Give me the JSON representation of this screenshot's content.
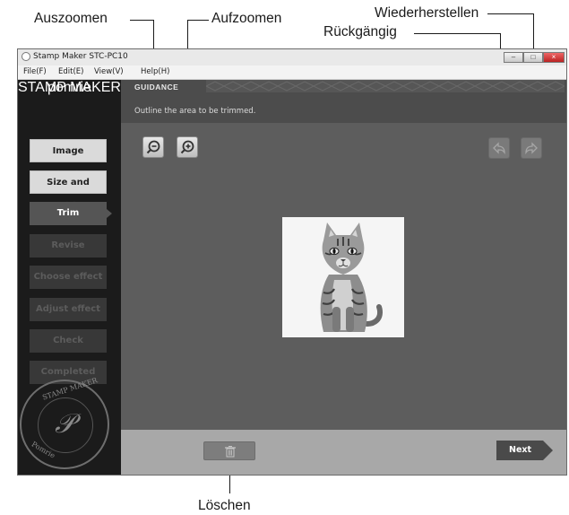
{
  "callouts": {
    "zoom_out": "Auszoomen",
    "zoom_in": "Aufzoomen",
    "redo": "Wiederherstellen",
    "undo": "Rückgängig",
    "delete": "Löschen"
  },
  "window": {
    "title": "Stamp Maker STC-PC10",
    "minimize_icon": "minimize-icon",
    "maximize_icon": "maximize-icon",
    "close_icon": "close-icon"
  },
  "menu": {
    "items": [
      "File(F)",
      "Edit(E)",
      "View(V)",
      "Help(H)"
    ]
  },
  "logo": {
    "name": "pomrie",
    "tagline": "STAMP MAKER"
  },
  "steps": [
    {
      "label": "Image selection",
      "state": "done"
    },
    {
      "label": "Size and position",
      "state": "done"
    },
    {
      "label": "Trim",
      "state": "active"
    },
    {
      "label": "Revise",
      "state": "future"
    },
    {
      "label": "Choose effect",
      "state": "future"
    },
    {
      "label": "Adjust effect",
      "state": "future"
    },
    {
      "label": "Check",
      "state": "future"
    },
    {
      "label": "Completed",
      "state": "future"
    }
  ],
  "seal": {
    "text_top": "STAMP MAKER",
    "text_bottom": "Pomrie"
  },
  "guidance": {
    "tab": "GUIDANCE",
    "text": "Outline the area to be trimmed."
  },
  "tools": {
    "zoom_out_icon": "zoom-out-icon",
    "zoom_in_icon": "zoom-in-icon",
    "undo_icon": "undo-icon",
    "redo_icon": "redo-icon"
  },
  "footer": {
    "delete_icon": "trash-icon",
    "next_label": "Next"
  },
  "colors": {
    "sidebar": "#1b1b1b",
    "canvas": "#5d5d5d",
    "footer": "#a8a8a8",
    "active_step": "#555555"
  }
}
